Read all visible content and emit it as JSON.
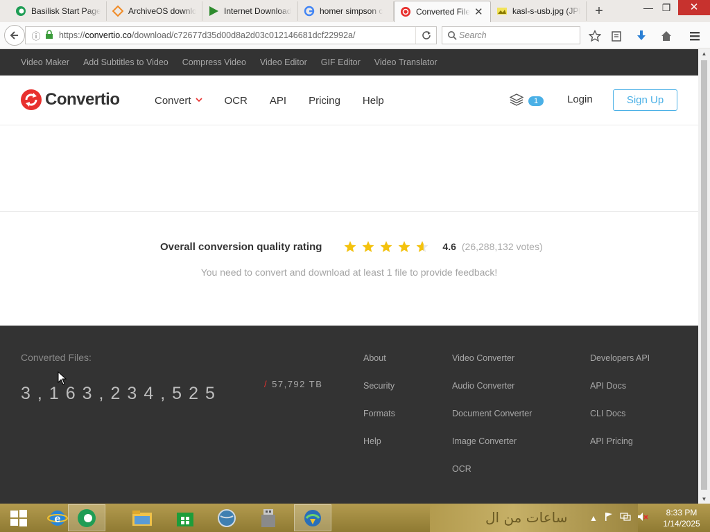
{
  "browser": {
    "tabs": [
      {
        "title": "Basilisk Start Page",
        "icon": "basilisk-icon",
        "color": "#1f9d55"
      },
      {
        "title": "ArchiveOS downloa",
        "icon": "archiveos-icon",
        "color": "#f08a24"
      },
      {
        "title": "Internet Download",
        "icon": "idm-icon",
        "color": "#2e8b2e"
      },
      {
        "title": "homer simpson c",
        "icon": "google-icon",
        "color": "#4285f4"
      },
      {
        "title": "Converted File",
        "icon": "convertio-icon",
        "color": "#e8302e",
        "active": true
      },
      {
        "title": "kasl-s-usb.jpg (JPE",
        "icon": "image-icon",
        "color": "#d6c200"
      }
    ],
    "url": {
      "prefix": "https://",
      "host": "convertio.co",
      "path": "/download/c72677d35d00d8a2d03c012146681dcf22992a/"
    },
    "search_placeholder": "Search"
  },
  "site": {
    "subnav": [
      "Video Maker",
      "Add Subtitles to Video",
      "Compress Video",
      "Video Editor",
      "GIF Editor",
      "Video Translator"
    ],
    "brand": "Convertio",
    "nav": [
      {
        "label": "Convert",
        "dropdown": true
      },
      {
        "label": "OCR"
      },
      {
        "label": "API"
      },
      {
        "label": "Pricing"
      },
      {
        "label": "Help"
      }
    ],
    "stack_count": "1",
    "login": "Login",
    "signup": "Sign Up"
  },
  "rating": {
    "title": "Overall conversion quality rating",
    "value": 4.6,
    "score_text": "4.6",
    "votes": "(26,288,132 votes)",
    "feedback": "You need to convert and download at least 1 file to provide feedback!",
    "star_color": "#f4c20d"
  },
  "footer": {
    "converted_label": "Converted Files:",
    "converted_count": "3,163,234,525",
    "slash": "/",
    "size": "57,792 TB",
    "col1": [
      "About",
      "Security",
      "Formats",
      "Help"
    ],
    "col2": [
      "Video Converter",
      "Audio Converter",
      "Document Converter",
      "Image Converter",
      "OCR"
    ],
    "col3": [
      "Developers API",
      "API Docs",
      "CLI Docs",
      "API Pricing"
    ]
  },
  "taskbar": {
    "time": "8:33 PM",
    "date": "1/14/2025",
    "wallpaper_text": "ساعات من ال"
  },
  "colors": {
    "brand_red": "#e8302e",
    "accent_blue": "#4ab0e6",
    "dark_bg": "#333333"
  }
}
